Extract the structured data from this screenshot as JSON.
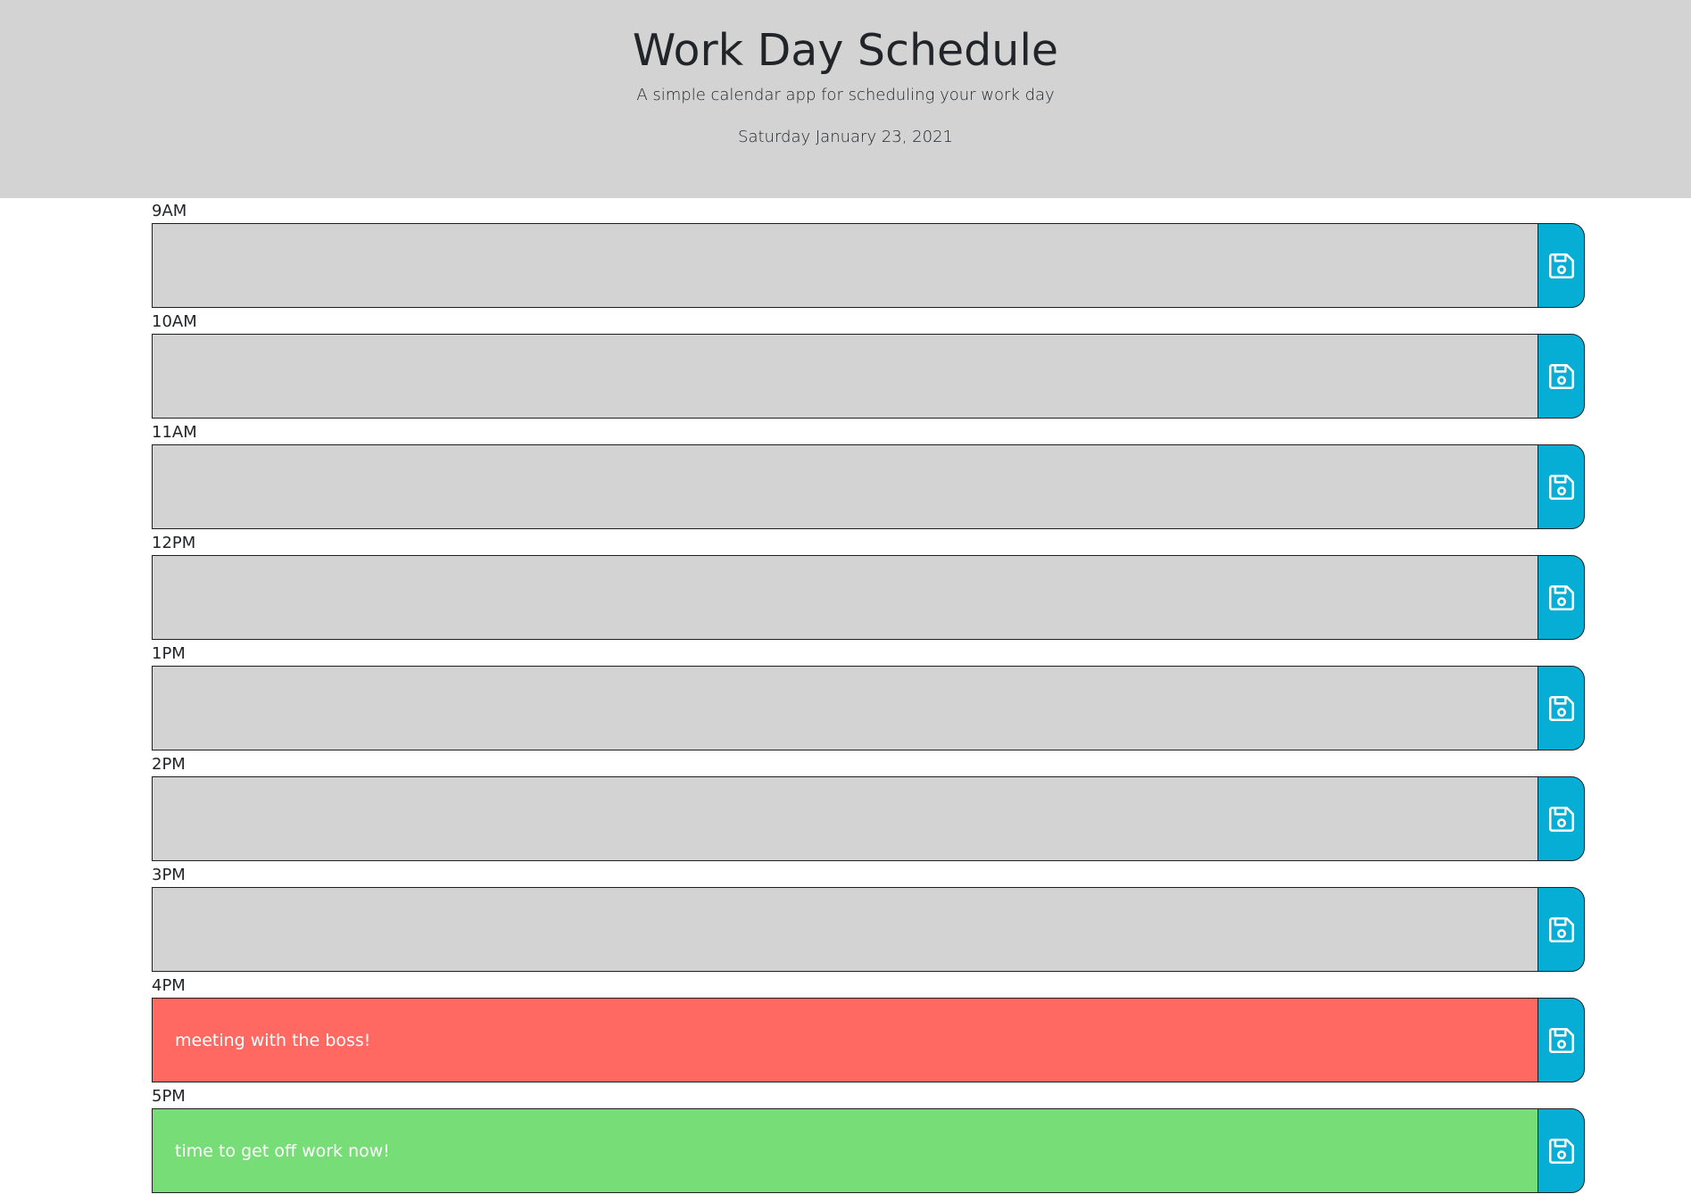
{
  "header": {
    "title": "Work Day Schedule",
    "lead": "A simple calendar app for scheduling your work day",
    "current_day": "Saturday January 23, 2021"
  },
  "colors": {
    "header_bg": "#d3d3d3",
    "past": "#d3d3d3",
    "present": "#ff6961",
    "future": "#77dd77",
    "save_button": "#06aed5"
  },
  "blocks": [
    {
      "hour": "9AM",
      "text": "",
      "state": "past",
      "save_icon": "save-icon"
    },
    {
      "hour": "10AM",
      "text": "",
      "state": "past",
      "save_icon": "save-icon"
    },
    {
      "hour": "11AM",
      "text": "",
      "state": "past",
      "save_icon": "save-icon"
    },
    {
      "hour": "12PM",
      "text": "",
      "state": "past",
      "save_icon": "save-icon"
    },
    {
      "hour": "1PM",
      "text": "",
      "state": "past",
      "save_icon": "save-icon"
    },
    {
      "hour": "2PM",
      "text": "",
      "state": "past",
      "save_icon": "save-icon"
    },
    {
      "hour": "3PM",
      "text": "",
      "state": "past",
      "save_icon": "save-icon"
    },
    {
      "hour": "4PM",
      "text": "meeting with the boss!",
      "state": "present",
      "save_icon": "save-icon"
    },
    {
      "hour": "5PM",
      "text": "time to get off work now!",
      "state": "future",
      "save_icon": "save-icon"
    }
  ]
}
